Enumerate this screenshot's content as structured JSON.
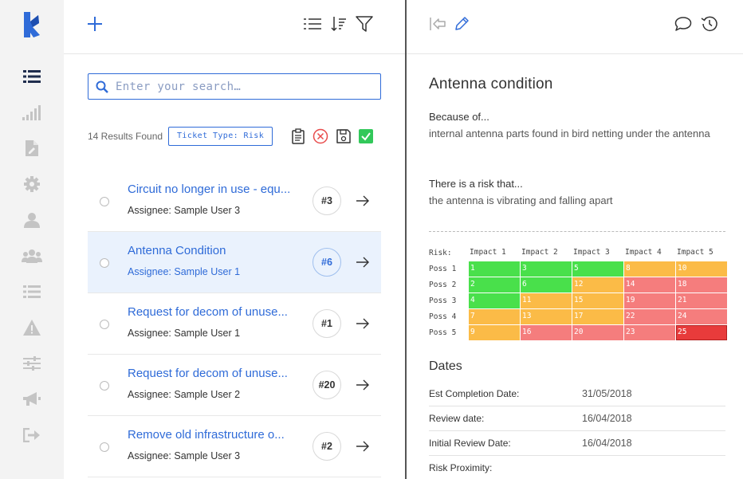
{
  "rail": {
    "items": [
      {
        "name": "rail-item-list",
        "icon": "list-icon",
        "active": true
      },
      {
        "name": "rail-item-reports",
        "icon": "bar-chart-icon"
      },
      {
        "name": "rail-item-documents",
        "icon": "document-edit-icon"
      },
      {
        "name": "rail-item-settings",
        "icon": "gear-icon"
      },
      {
        "name": "rail-item-user",
        "icon": "user-icon"
      },
      {
        "name": "rail-item-team",
        "icon": "users-icon"
      },
      {
        "name": "rail-item-tasks",
        "icon": "task-list-icon"
      },
      {
        "name": "rail-item-alerts",
        "icon": "warning-icon"
      },
      {
        "name": "rail-item-adjust",
        "icon": "sliders-icon"
      },
      {
        "name": "rail-item-announce",
        "icon": "megaphone-icon"
      },
      {
        "name": "rail-item-logout",
        "icon": "sign-out-icon"
      }
    ]
  },
  "search": {
    "placeholder": "Enter your search…"
  },
  "list": {
    "results_label": "14 Results Found",
    "filter_tag": "Ticket Type: Risk",
    "tickets": [
      {
        "title": "Circuit no longer in use - equ...",
        "assignee": "Assignee: Sample User 3",
        "number": "#3",
        "selected": false
      },
      {
        "title": "Antenna Condition",
        "assignee": "Assignee: Sample User 1",
        "number": "#6",
        "selected": true
      },
      {
        "title": "Request for decom of unuse...",
        "assignee": "Assignee: Sample User 1",
        "number": "#1",
        "selected": false
      },
      {
        "title": "Request for decom of unuse...",
        "assignee": "Assignee: Sample User 2",
        "number": "#20",
        "selected": false
      },
      {
        "title": "Remove old infrastructure o...",
        "assignee": "Assignee: Sample User 3",
        "number": "#2",
        "selected": false
      }
    ]
  },
  "detail": {
    "title": "Antenna condition",
    "because_label": "Because of...",
    "because_text": "internal antenna parts found in bird netting under the antenna",
    "risk_label": "There is a risk that...",
    "risk_text": "the antenna is vibrating and falling apart",
    "matrix": {
      "corner": "Risk:",
      "impacts": [
        "Impact 1",
        "Impact 2",
        "Impact 3",
        "Impact 4",
        "Impact 5"
      ],
      "rows": [
        {
          "label": "Poss 1",
          "cells": [
            "1",
            "3",
            "5",
            "8",
            "10"
          ],
          "colors": [
            "#49e04b",
            "#49e04b",
            "#49e04b",
            "#fbbb47",
            "#fbbb47"
          ]
        },
        {
          "label": "Poss 2",
          "cells": [
            "2",
            "6",
            "12",
            "14",
            "18"
          ],
          "colors": [
            "#49e04b",
            "#49e04b",
            "#fbbb47",
            "#f57d7d",
            "#f57d7d"
          ]
        },
        {
          "label": "Poss 3",
          "cells": [
            "4",
            "11",
            "15",
            "19",
            "21"
          ],
          "colors": [
            "#49e04b",
            "#fbbb47",
            "#fbbb47",
            "#f57d7d",
            "#f57d7d"
          ]
        },
        {
          "label": "Poss 4",
          "cells": [
            "7",
            "13",
            "17",
            "22",
            "24"
          ],
          "colors": [
            "#fbbb47",
            "#fbbb47",
            "#fbbb47",
            "#f57d7d",
            "#f57d7d"
          ]
        },
        {
          "label": "Poss 5",
          "cells": [
            "9",
            "16",
            "20",
            "23",
            "25"
          ],
          "colors": [
            "#fbbb47",
            "#f57d7d",
            "#f57d7d",
            "#f57d7d",
            "#e83b3b"
          ]
        }
      ]
    },
    "dates_heading": "Dates",
    "dates": [
      {
        "label": "Est Completion Date:",
        "value": "31/05/2018"
      },
      {
        "label": "Review date:",
        "value": "16/04/2018"
      },
      {
        "label": "Initial Review Date:",
        "value": "16/04/2018"
      },
      {
        "label": "Risk Proximity:",
        "value": ""
      }
    ]
  },
  "colors": {
    "accent": "#2f6bd8",
    "selected_row": "#eaf2fd",
    "rail_bg": "#f3f3f3",
    "rail_icon": "#c4c4c4",
    "rail_active": "#1f2d4d"
  }
}
